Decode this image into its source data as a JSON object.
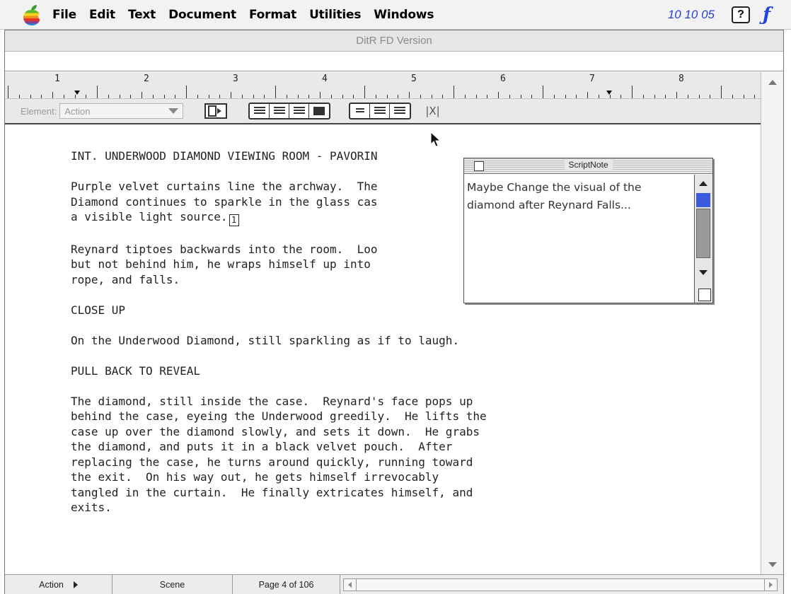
{
  "menubar": {
    "items": [
      "File",
      "Edit",
      "Text",
      "Document",
      "Format",
      "Utilities",
      "Windows"
    ],
    "clock": "10 10 05",
    "help_icon": "help-question-icon",
    "app_icon": "final-draft-f-icon"
  },
  "window": {
    "title": "DitR FD Version"
  },
  "ruler": {
    "numbers": [
      "1",
      "2",
      "3",
      "4",
      "5",
      "6",
      "7",
      "8"
    ]
  },
  "toolbar": {
    "element_label": "Element:",
    "element_value": "Action",
    "close_glyph": "|X|"
  },
  "script": {
    "paragraphs": [
      "INT. UNDERWOOD DIAMOND VIEWING ROOM - PAVORIN",
      "Purple velvet curtains line the archway.  The\nDiamond continues to sparkle in the glass cas\na visible light source.",
      "Reynard tiptoes backwards into the room.  Loo\nbut not behind him, he wraps himself up into \nrope, and falls.",
      "CLOSE UP",
      "On the Underwood Diamond, still sparkling as if to laugh.",
      "PULL BACK TO REVEAL",
      "The diamond, still inside the case.  Reynard's face pops up\nbehind the case, eyeing the Underwood greedily.  He lifts the\ncase up over the diamond slowly, and sets it down.  He grabs\nthe diamond, and puts it in a black velvet pouch.  After\nreplacing the case, he turns around quickly, running toward\nthe exit.  On his way out, he gets himself irrevocably\ntangled in the curtain.  He finally extricates himself, and\nexits."
    ],
    "note_marker": "1"
  },
  "scriptnote": {
    "title": "ScriptNote",
    "text": "Maybe Change the visual of the diamond after Reynard Falls..."
  },
  "statusbar": {
    "element": "Action",
    "scene": "Scene",
    "page": "Page 4 of 106"
  }
}
